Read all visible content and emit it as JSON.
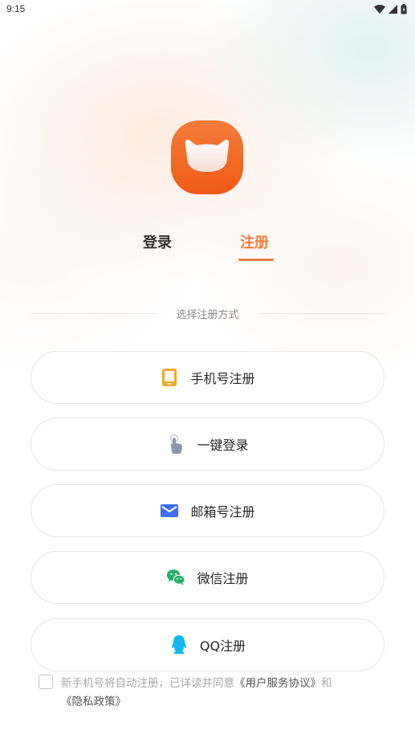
{
  "status_bar": {
    "time": "9:15"
  },
  "tabs": {
    "login": "登录",
    "register": "注册",
    "active": "register"
  },
  "divider": {
    "text": "选择注册方式"
  },
  "options": [
    {
      "label": "手机号注册",
      "icon": "phone-icon",
      "color": "#f5a623"
    },
    {
      "label": "一键登录",
      "icon": "touch-icon",
      "color": "#8a98a8"
    },
    {
      "label": "邮箱号注册",
      "icon": "mail-icon",
      "color": "#3b6ef5"
    },
    {
      "label": "微信注册",
      "icon": "wechat-icon",
      "color": "#2aae67"
    },
    {
      "label": "QQ注册",
      "icon": "qq-icon",
      "color": "#12b7f5"
    }
  ],
  "agreement": {
    "prefix": "新手机号将自动注册，已详读并同意",
    "user_agreement": "《用户服务协议》",
    "and": "和",
    "privacy_policy": "《隐私政策》",
    "checked": false
  },
  "colors": {
    "accent": "#f07a3c",
    "logo": "#f26a24"
  }
}
